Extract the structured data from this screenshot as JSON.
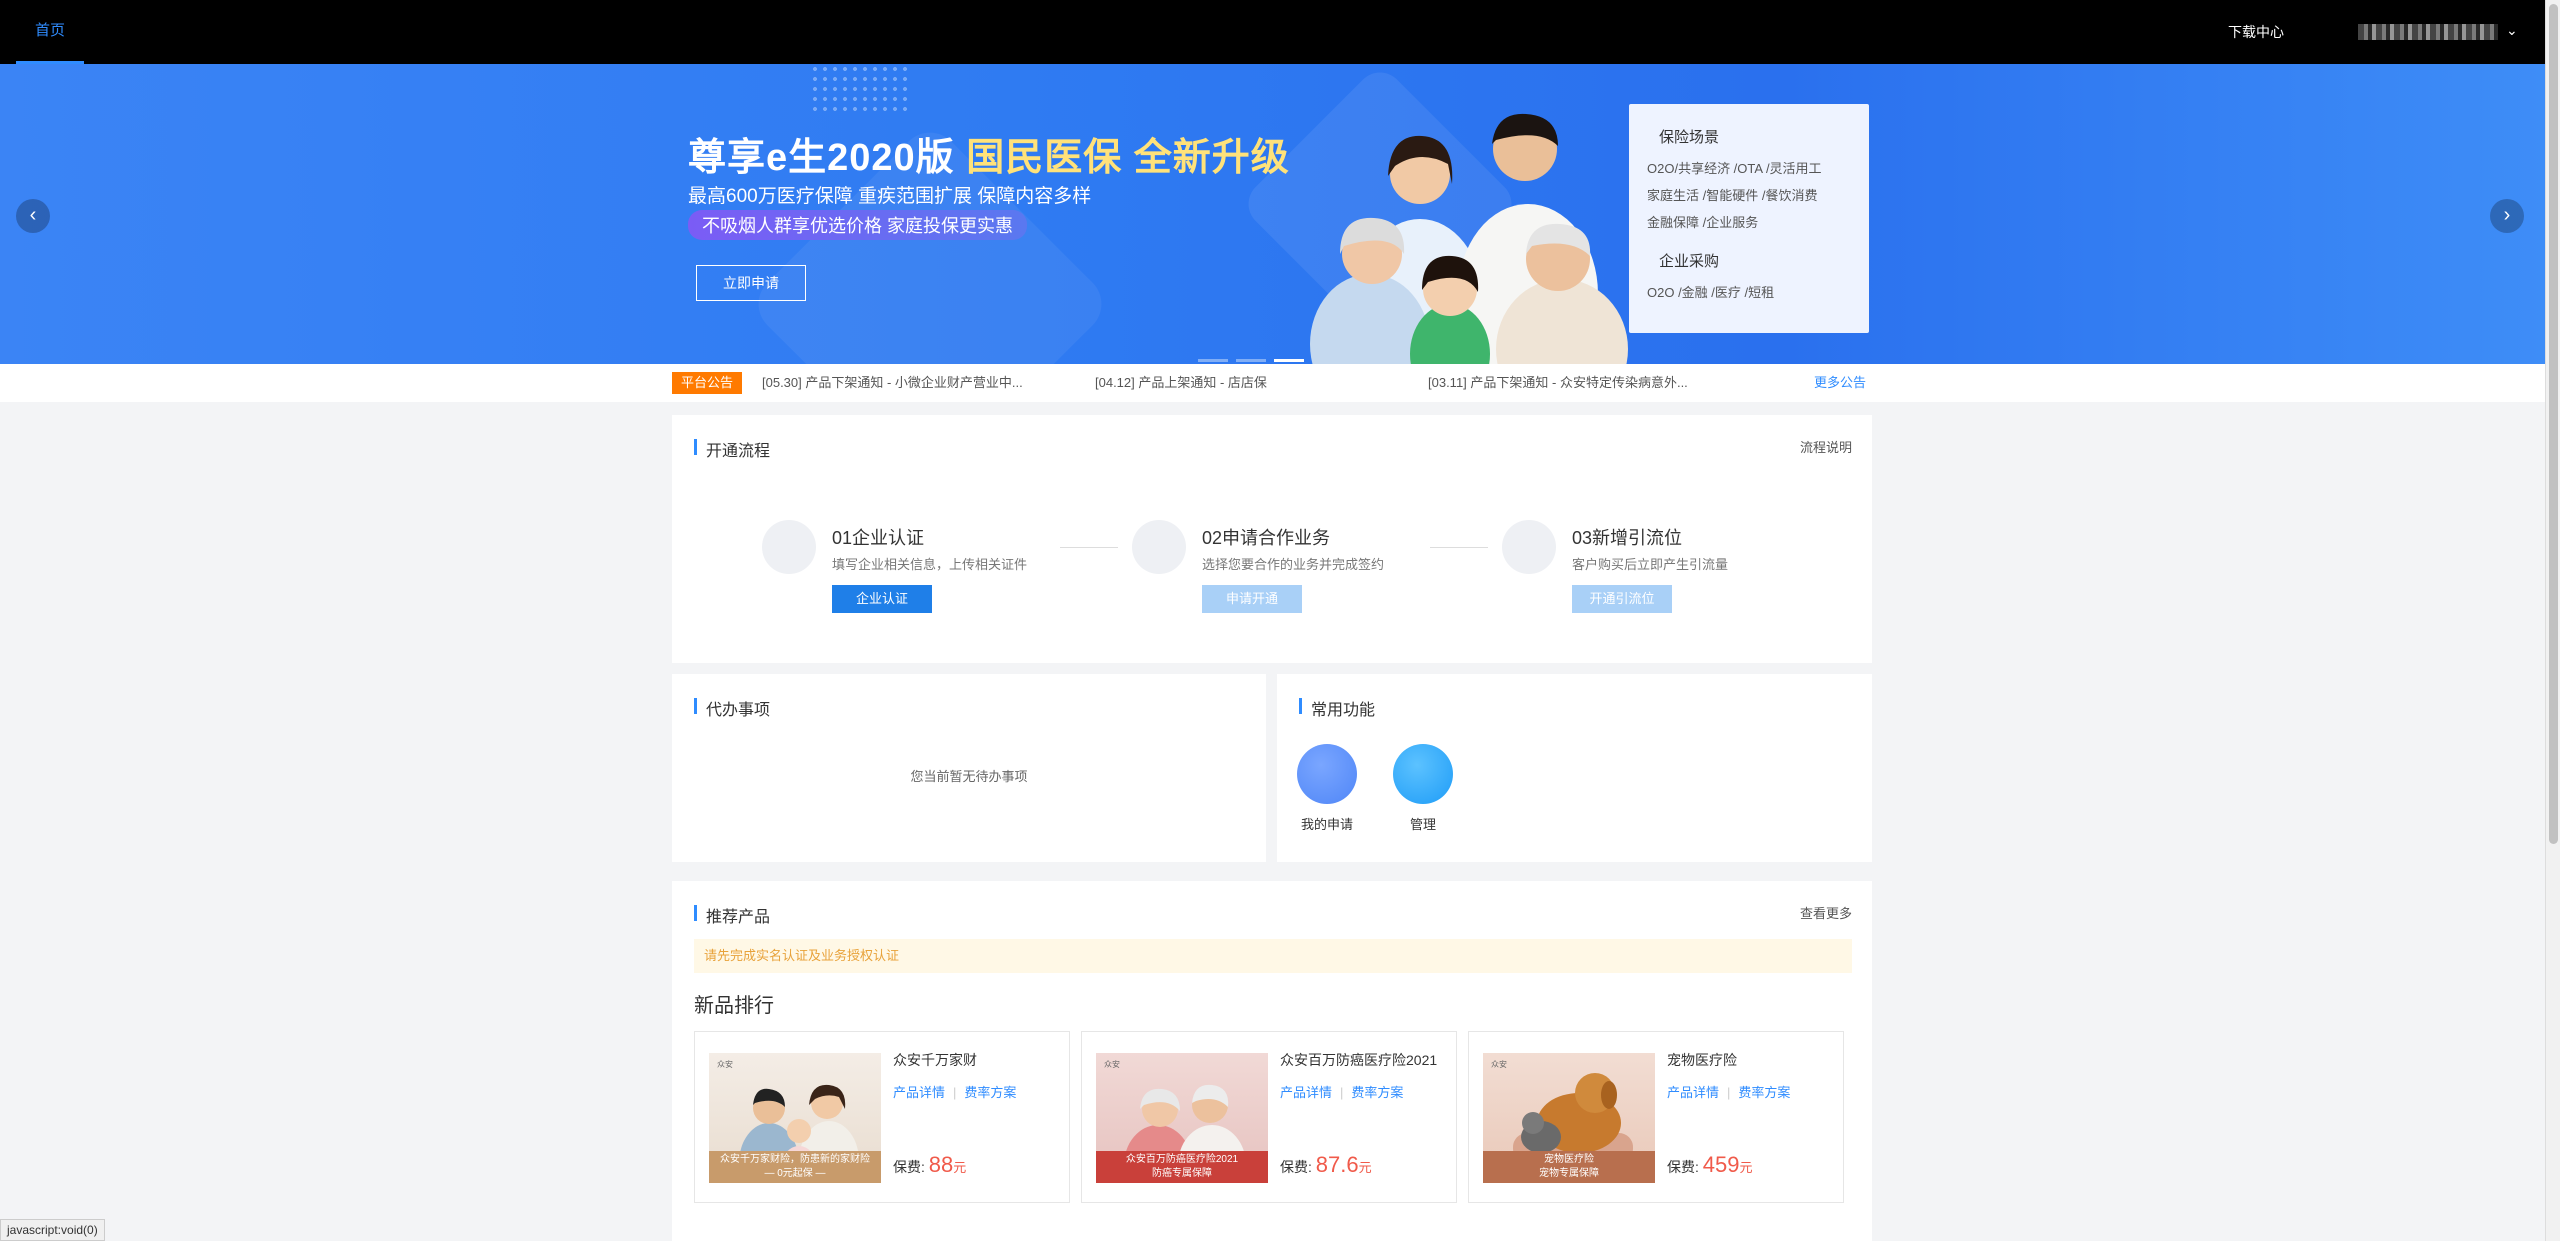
{
  "nav": {
    "home": "首页",
    "download": "下载中心",
    "caret": "⌄"
  },
  "banner": {
    "title_a": "尊享e生2020版 ",
    "title_b": "国民医保 全新升级",
    "subtitle": "最高600万医疗保障  重疾范围扩展  保障内容多样",
    "pill": "不吸烟人群享优选价格  家庭投保更实惠",
    "cta": "立即申请",
    "prev": "‹",
    "next": "›",
    "scene_title_1": "保险场景",
    "scene_line_1": "O2O/共享经济 /OTA /灵活用工",
    "scene_line_2": "家庭生活 /智能硬件 /餐饮消费",
    "scene_line_3": "金融保障 /企业服务",
    "scene_title_2": "企业采购",
    "scene_line_4": "O2O /金融 /医疗 /短租"
  },
  "notice": {
    "tag": "平台公告",
    "items": [
      "[05.30] 产品下架通知 - 小微企业财产营业中...",
      "[04.12] 产品上架通知 - 店店保",
      "[03.11] 产品下架通知 - 众安特定传染病意外..."
    ],
    "more": "更多公告"
  },
  "process": {
    "title": "开通流程",
    "link": "流程说明",
    "steps": [
      {
        "name": "01企业认证",
        "desc": "填写企业相关信息，上传相关证件",
        "button": "企业认证"
      },
      {
        "name": "02申请合作业务",
        "desc": "选择您要合作的业务并完成签约",
        "button": "申请开通"
      },
      {
        "name": "03新增引流位",
        "desc": "客户购买后立即产生引流量",
        "button": "开通引流位"
      }
    ]
  },
  "todo": {
    "title": "代办事项",
    "empty": "您当前暂无待办事项"
  },
  "functions": {
    "title": "常用功能",
    "items": [
      {
        "label": "我的申请",
        "color": "#4f86f7"
      },
      {
        "label": "管理",
        "color": "#1e9cf7"
      }
    ]
  },
  "products": {
    "title": "推荐产品",
    "link": "查看更多",
    "warning": "请先完成实名认证及业务授权认证",
    "rank_title": "新品排行",
    "items": [
      {
        "name": "众安千万家财",
        "detail": "产品详情",
        "rate": "费率方案",
        "price_label": "保费: ",
        "price": "88",
        "unit": "元"
      },
      {
        "name": "众安百万防癌医疗险2021",
        "detail": "产品详情",
        "rate": "费率方案",
        "price_label": "保费: ",
        "price": "87.6",
        "unit": "元"
      },
      {
        "name": "宠物医疗险",
        "detail": "产品详情",
        "rate": "费率方案",
        "price_label": "保费: ",
        "price": "459",
        "unit": "元"
      }
    ]
  },
  "statusbar": "javascript:void(0)",
  "colors": {
    "accent": "#2f8cff",
    "notice_tag": "#ff7a00",
    "price": "#f05a4a",
    "topbar": "#000000"
  }
}
